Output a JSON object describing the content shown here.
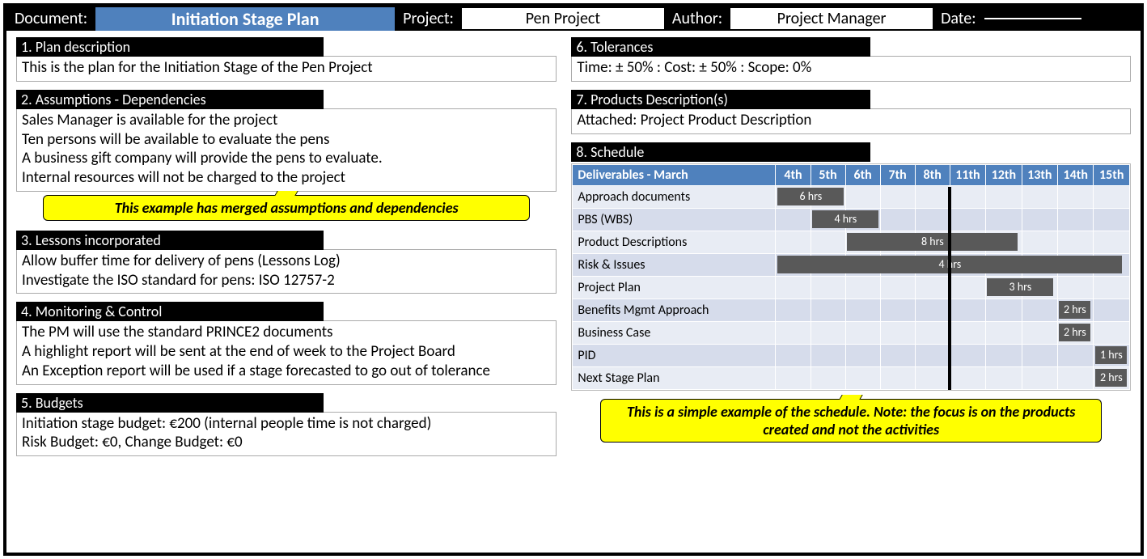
{
  "header": {
    "document_label": "Document:",
    "document_title": "Initiation Stage Plan",
    "project_label": "Project:",
    "project_value": "Pen Project",
    "author_label": "Author:",
    "author_value": "Project Manager",
    "date_label": "Date:",
    "date_value": ""
  },
  "sections": {
    "plan_desc": {
      "title": "1. Plan description",
      "body": "This is the plan for the Initiation Stage of the Pen Project"
    },
    "assumptions": {
      "title": "2. Assumptions - Dependencies",
      "body": "Sales Manager is available for the project\nTen persons will be available to evaluate the pens\nA business gift company will provide the pens to evaluate.\nInternal resources will not be charged to the project"
    },
    "lessons": {
      "title": "3. Lessons incorporated",
      "body": "Allow buffer time for delivery of pens (Lessons Log)\nInvestigate the ISO standard for pens: ISO 12757-2"
    },
    "monitoring": {
      "title": "4. Monitoring & Control",
      "body": "The PM will use the standard PRINCE2 documents\nA highlight report will be sent at the end of week to the Project Board\nAn Exception report will be used if a stage forecasted to go out of tolerance"
    },
    "budgets": {
      "title": "5. Budgets",
      "body": "Initiation stage budget: €200 (internal people time is not charged)\nRisk Budget: €0,  Change Budget: €0"
    },
    "tolerances": {
      "title": "6. Tolerances",
      "body": "Time: ± 50% : Cost: ± 50% : Scope: 0%"
    },
    "products": {
      "title": "7. Products Description(s)",
      "body": "Attached: Project Product Description"
    },
    "schedule_title": "8. Schedule"
  },
  "notes": {
    "assumptions_note": "This example has merged assumptions and dependencies",
    "schedule_note": "This is a simple example of the schedule. Note: the focus is on the products created and not the activities"
  },
  "chart_data": {
    "type": "gantt",
    "header_label": "Deliverables - March",
    "columns": [
      "4th",
      "5th",
      "6th",
      "7th",
      "8th",
      "11th",
      "12th",
      "13th",
      "14th",
      "15th"
    ],
    "marker_after_column_index": 5,
    "rows": [
      {
        "name": "Approach documents",
        "start": 0,
        "span": 2,
        "label": "6 hrs"
      },
      {
        "name": "PBS (WBS)",
        "start": 1,
        "span": 2,
        "label": "4 hrs"
      },
      {
        "name": "Product Descriptions",
        "start": 2,
        "span": 5,
        "label": "8 hrs"
      },
      {
        "name": "Risk & Issues",
        "start": 0,
        "span": 10,
        "label": "4 hrs"
      },
      {
        "name": "Project Plan",
        "start": 6,
        "span": 2,
        "label": "3 hrs"
      },
      {
        "name": "Benefits Mgmt Approach",
        "start": 8,
        "span": 1,
        "label": "2 hrs"
      },
      {
        "name": "Business Case",
        "start": 8,
        "span": 1,
        "label": "2 hrs"
      },
      {
        "name": "PID",
        "start": 9,
        "span": 1,
        "label": "1 hrs"
      },
      {
        "name": "Next Stage Plan",
        "start": 9,
        "span": 1,
        "label": "2 hrs"
      }
    ]
  }
}
